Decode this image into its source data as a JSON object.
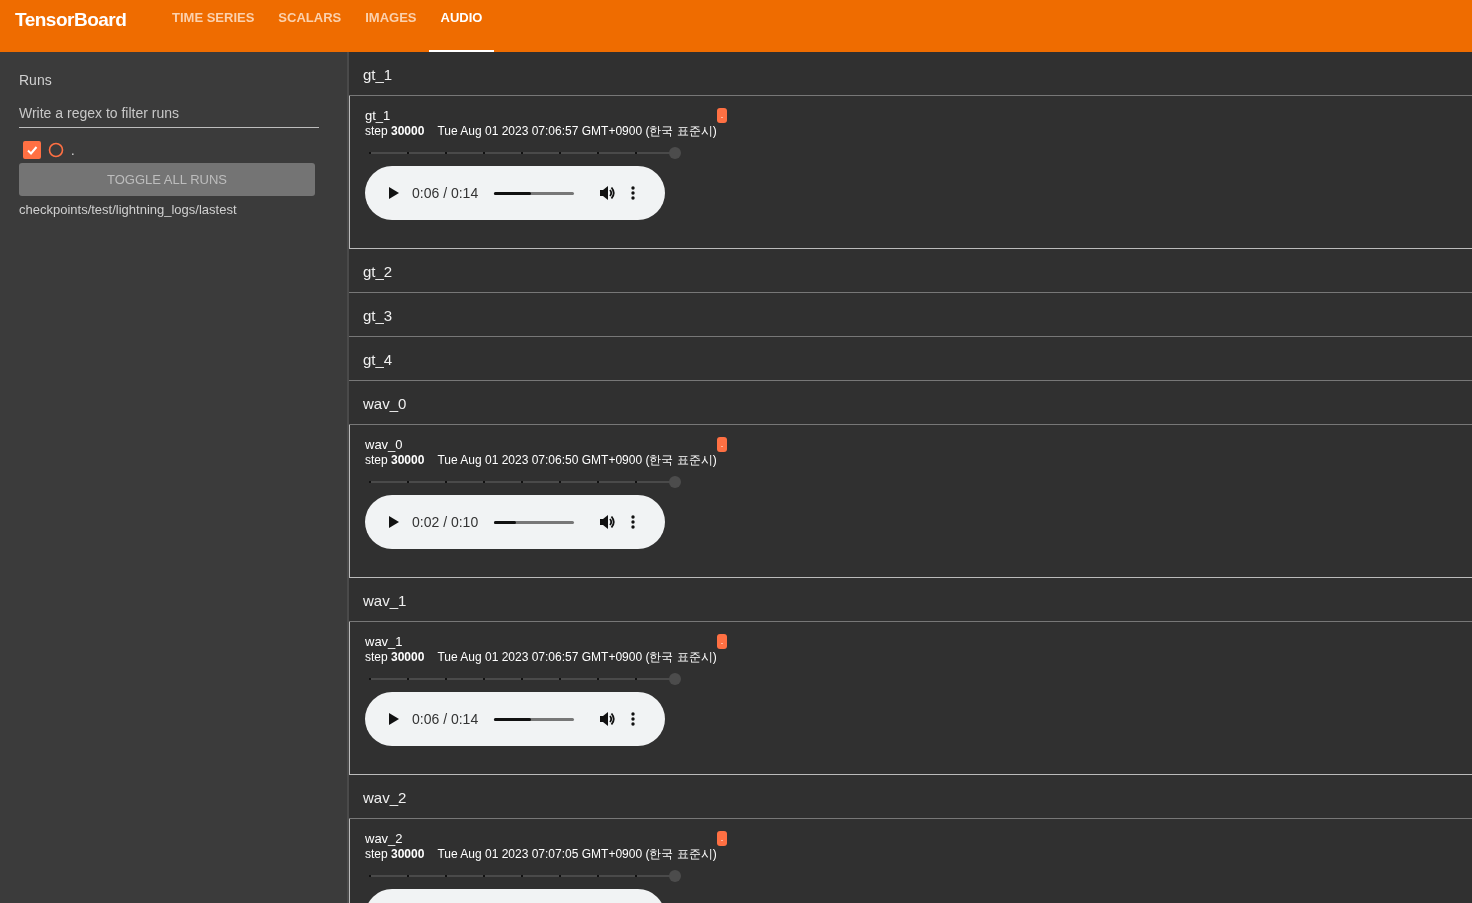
{
  "app": {
    "title": "TensorBoard"
  },
  "tabs": [
    {
      "label": "TIME SERIES",
      "selected": false
    },
    {
      "label": "SCALARS",
      "selected": false
    },
    {
      "label": "IMAGES",
      "selected": false
    },
    {
      "label": "AUDIO",
      "selected": true
    }
  ],
  "sidebar": {
    "heading": "Runs",
    "filter": {
      "placeholder": "Write a regex to filter runs"
    },
    "runs": [
      {
        "label": ".",
        "checked": true,
        "color": "#ff7043"
      }
    ],
    "toggle_button": "TOGGLE ALL RUNS",
    "run_path": "checkpoints/test/lightning_logs/lastest"
  },
  "groups": [
    {
      "title": "gt_1",
      "card": {
        "title": "gt_1",
        "run_badge": ".",
        "step_label": "step **30000**",
        "time": "Tue Aug 01 2023 07:06:57 GMT+0900 (한국 표준시)",
        "step_slider": {
          "level": 1
        },
        "player": {
          "kind": "full",
          "time": "0:06 / 0:14",
          "level": 0.46
        }
      }
    },
    {
      "title": "gt_2"
    },
    {
      "title": "gt_3"
    },
    {
      "title": "gt_4"
    },
    {
      "title": "wav_0",
      "card": {
        "title": "wav_0",
        "run_badge": ".",
        "step_label": "step **30000**",
        "time": "Tue Aug 01 2023 07:06:50 GMT+0900 (한국 표준시)",
        "step_slider": {
          "level": 1
        },
        "player": {
          "kind": "full",
          "time": "0:02 / 0:10",
          "level": 0.27
        }
      }
    },
    {
      "title": "wav_1",
      "card": {
        "title": "wav_1",
        "run_badge": ".",
        "step_label": "step **30000**",
        "time": "Tue Aug 01 2023 07:06:57 GMT+0900 (한국 표준시)",
        "step_slider": {
          "level": 1
        },
        "player": {
          "kind": "full",
          "time": "0:06 / 0:14",
          "level": 0.46
        }
      }
    },
    {
      "title": "wav_2",
      "card": {
        "title": "wav_2",
        "run_badge": ".",
        "step_label": "step **30000**",
        "time": "Tue Aug 01 2023 07:07:05 GMT+0900 (한국 표준시)",
        "step_slider": {
          "level": 1
        },
        "player": {
          "kind": "top_edge"
        }
      }
    }
  ]
}
